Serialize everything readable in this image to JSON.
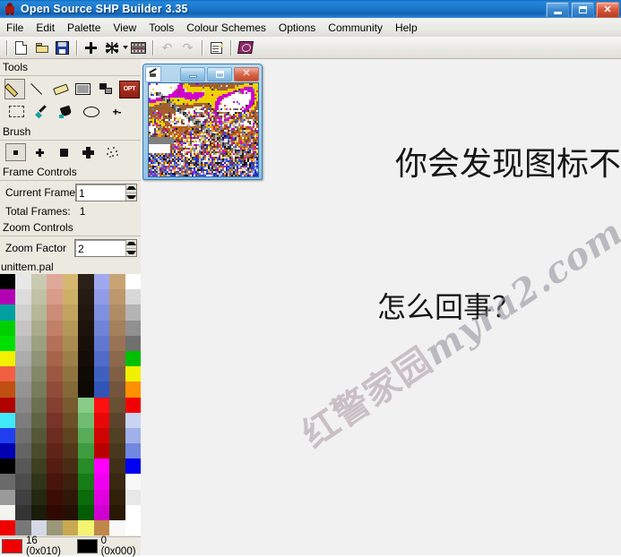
{
  "window": {
    "title": "Open Source SHP Builder 3.35",
    "app_icon": "soldier-icon",
    "controls": {
      "minimize": "minimize-icon",
      "maximize": "maximize-icon",
      "close": "close-icon"
    }
  },
  "menubar": {
    "items": [
      {
        "label": "File"
      },
      {
        "label": "Edit"
      },
      {
        "label": "Palette"
      },
      {
        "label": "View"
      },
      {
        "label": "Tools"
      },
      {
        "label": "Colour Schemes"
      },
      {
        "label": "Options"
      },
      {
        "label": "Community"
      },
      {
        "label": "Help"
      }
    ]
  },
  "toolbar": {
    "buttons": [
      {
        "name": "new-file-icon",
        "tooltip": "New"
      },
      {
        "name": "open-file-icon",
        "tooltip": "Open"
      },
      {
        "name": "save-file-icon",
        "tooltip": "Save"
      },
      {
        "name": "add-frame-icon",
        "tooltip": "Add Frame"
      },
      {
        "name": "frames-icon",
        "tooltip": "Frames"
      },
      {
        "name": "palette-grid-icon",
        "tooltip": "Palette"
      },
      {
        "name": "undo-icon",
        "tooltip": "Undo"
      },
      {
        "name": "redo-icon",
        "tooltip": "Redo"
      },
      {
        "name": "properties-icon",
        "tooltip": "Properties"
      },
      {
        "name": "book-icon",
        "tooltip": "Help"
      }
    ]
  },
  "panels": {
    "tools": {
      "header": "Tools",
      "items": [
        {
          "name": "pencil-tool",
          "selected": true
        },
        {
          "name": "line-tool",
          "selected": false
        },
        {
          "name": "eraser-tool",
          "selected": false
        },
        {
          "name": "rectangle-tool",
          "selected": false
        },
        {
          "name": "shapes-tool",
          "selected": false
        },
        {
          "name": "opt-tool",
          "label": "OPT",
          "selected": false
        },
        {
          "name": "marquee-select-tool",
          "selected": false
        },
        {
          "name": "eyedropper-tool",
          "selected": false
        },
        {
          "name": "paint-bucket-tool",
          "selected": false
        },
        {
          "name": "ellipse-tool",
          "selected": false
        },
        {
          "name": "plus-minus-tool",
          "label": "+-",
          "selected": false
        }
      ]
    },
    "brush": {
      "header": "Brush",
      "items": [
        {
          "name": "brush-square-small",
          "selected": true
        },
        {
          "name": "brush-plus-small",
          "selected": false
        },
        {
          "name": "brush-square-large",
          "selected": false
        },
        {
          "name": "brush-plus-large",
          "selected": false
        },
        {
          "name": "brush-spray",
          "selected": false
        }
      ]
    },
    "frame_controls": {
      "header": "Frame Controls",
      "current_frame_label": "Current Frame",
      "current_frame_value": "1",
      "total_frames_label": "Total Frames:",
      "total_frames_value": "1"
    },
    "zoom_controls": {
      "header": "Zoom Controls",
      "zoom_factor_label": "Zoom Factor",
      "zoom_factor_value": "2"
    },
    "palette": {
      "filename": "unittem.pal",
      "columns": 9,
      "column_colors": [
        [
          "#000000",
          "#b400b4",
          "#00a0a0",
          "#00d000",
          "#00e000",
          "#f0f000",
          "#f06040",
          "#c05010",
          "#b00000",
          "#40e8f8",
          "#2040f0",
          "#0000b0",
          "#000000",
          "#6a6a6a",
          "#9a9a9a",
          "#f4f4f0",
          "#f00000"
        ],
        [
          "#e8e8e8",
          "#dcdcdc",
          "#d0d0d0",
          "#c4c4c4",
          "#b8b8b8",
          "#acacac",
          "#a0a0a0",
          "#949494",
          "#888888",
          "#7c7c7c",
          "#707070",
          "#646464",
          "#585858",
          "#4c4c4c",
          "#404040",
          "#343434",
          "#787878"
        ],
        [
          "#c8cab0",
          "#c0c2a4",
          "#b4b898",
          "#a8ac8c",
          "#9ca080",
          "#909474",
          "#848868",
          "#787c5c",
          "#6c7050",
          "#606444",
          "#545838",
          "#484c2c",
          "#3c4020",
          "#303418",
          "#242810",
          "#1a1c0a",
          "#d4d8e8"
        ],
        [
          "#e0a898",
          "#d89c88",
          "#cc8c78",
          "#c08068",
          "#b47058",
          "#a86448",
          "#9c5840",
          "#904c38",
          "#844030",
          "#783428",
          "#6c2c20",
          "#602418",
          "#541c12",
          "#48140c",
          "#3c0c06",
          "#300802",
          "#9a9878"
        ],
        [
          "#d4b870",
          "#ccb068",
          "#c0a460",
          "#b49858",
          "#a88c50",
          "#9c8048",
          "#907440",
          "#846838",
          "#785c30",
          "#6c5028",
          "#604420",
          "#54381a",
          "#482c14",
          "#3c200e",
          "#301808",
          "#241004",
          "#c8a850"
        ],
        [
          "#2a2018",
          "#241c14",
          "#201810",
          "#1c140c",
          "#181008",
          "#140c06",
          "#100a04",
          "#0c0802",
          "#88cc88",
          "#70bc70",
          "#58ac58",
          "#409c40",
          "#288c28",
          "#187c18",
          "#0c6c0c",
          "#045c04",
          "#f4f470"
        ],
        [
          "#a0a8f0",
          "#909ce8",
          "#8090e0",
          "#7084d8",
          "#6078d0",
          "#506cc8",
          "#4060c0",
          "#3054b8",
          "#ff1010",
          "#e80808",
          "#d00404",
          "#b80000",
          "#ff00ff",
          "#f000f0",
          "#e000e0",
          "#d000d0",
          "#c08848"
        ],
        [
          "#c8a474",
          "#bc986c",
          "#b08c64",
          "#a4805c",
          "#987454",
          "#8c684c",
          "#806044",
          "#74543c",
          "#685034",
          "#5c442c",
          "#504024",
          "#48381e",
          "#403018",
          "#382810",
          "#30200a",
          "#281804",
          "#f8f8f8"
        ],
        [
          "#fefefe",
          "#d8d8d8",
          "#b4b4b4",
          "#909090",
          "#707070",
          "#00c000",
          "#f0f000",
          "#ff9000",
          "#f00000",
          "#c8d4f0",
          "#a0b0e8",
          "#7088e0",
          "#0000f0",
          "#f8f8f8",
          "#e8e8e8",
          "#ffffff",
          "#ffffff"
        ]
      ]
    }
  },
  "statusbar": {
    "primary_color_hex": "#f00000",
    "primary_color_text": "16 (0x010)",
    "secondary_color_hex": "#000000",
    "secondary_color_text": "0 (0x000)"
  },
  "child_window": {
    "icon": "sprite-document-icon",
    "controls": {
      "minimize": "minimize-icon",
      "maximize": "maximize-icon",
      "close": "close-icon"
    }
  },
  "overlays": {
    "line1": "你会发现图标不对劲",
    "line2": "怎么回事？",
    "watermark_cjk": "红警家园",
    "watermark_latin": "myra2.com"
  }
}
